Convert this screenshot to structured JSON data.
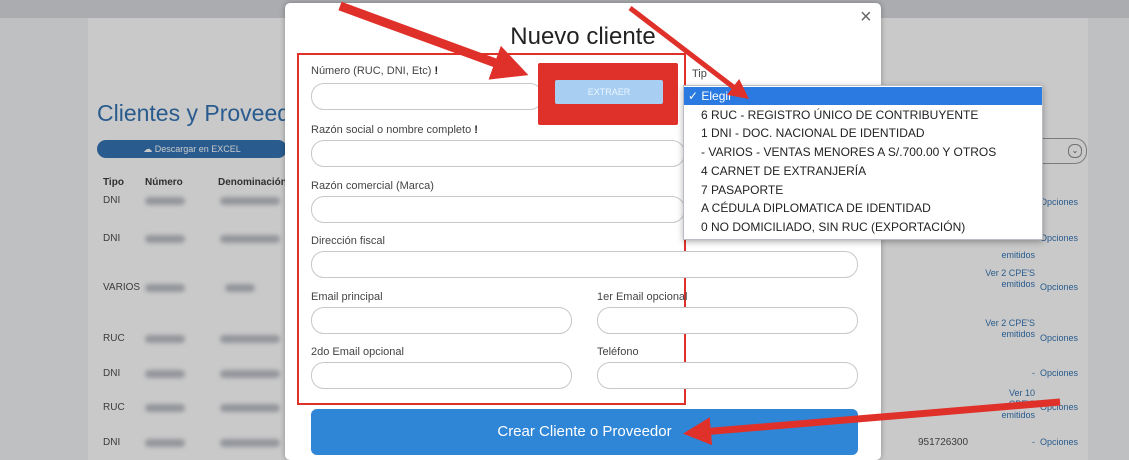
{
  "background": {
    "page_title": "Clientes y Proveedo",
    "excel_button": "Descargar en EXCEL",
    "columns": [
      "Tipo",
      "Número",
      "Denominación"
    ],
    "rows": [
      {
        "tipo": "DNI",
        "options": "Opciones"
      },
      {
        "tipo": "DNI",
        "options": "Opciones"
      },
      {
        "tipo": "VARIOS",
        "ver": "Ver 2 CPE'S emitidos",
        "options": "Opciones"
      },
      {
        "tipo": "RUC",
        "ver": "Ver 2 CPE'S emitidos",
        "options": "Opciones"
      },
      {
        "tipo": "DNI",
        "ver": "-",
        "options": "Opciones"
      },
      {
        "tipo": "RUC",
        "ver": "Ver 10 CPE'S emitidos",
        "options": "Opciones"
      },
      {
        "tipo": "DNI",
        "phone": "951726300",
        "ver": "-",
        "options": "Opciones"
      }
    ],
    "row2_ver_tail": "emitidos"
  },
  "modal": {
    "title": "Nuevo cliente",
    "close": "×",
    "numero_label": "Número (RUC, DNI, Etc)",
    "required_mark": "!",
    "extract_button": "EXTRAER",
    "tipo_label": "Tip",
    "razon_social_label": "Razón social o nombre completo",
    "razon_comercial_label": "Razón comercial (Marca)",
    "direccion_label": "Dirección fiscal",
    "email_label": "Email principal",
    "email1_opt_label": "1er Email opcional",
    "email2_opt_label": "2do Email opcional",
    "telefono_label": "Teléfono",
    "create_button": "Crear Cliente o Proveedor"
  },
  "dropdown": {
    "selected": "✓ Elegir",
    "options": [
      "6 RUC - REGISTRO ÚNICO DE CONTRIBUYENTE",
      "1 DNI - DOC. NACIONAL DE IDENTIDAD",
      "- VARIOS - VENTAS MENORES A S/.700.00 Y OTROS",
      "4 CARNET DE EXTRANJERÍA",
      "7 PASAPORTE",
      "A CÉDULA DIPLOMATICA DE IDENTIDAD",
      "0 NO DOMICILIADO, SIN RUC (EXPORTACIÓN)"
    ]
  },
  "colors": {
    "accent": "#2f86d6",
    "annotation_red": "#e0302a",
    "selected_option": "#2a7ae2"
  }
}
